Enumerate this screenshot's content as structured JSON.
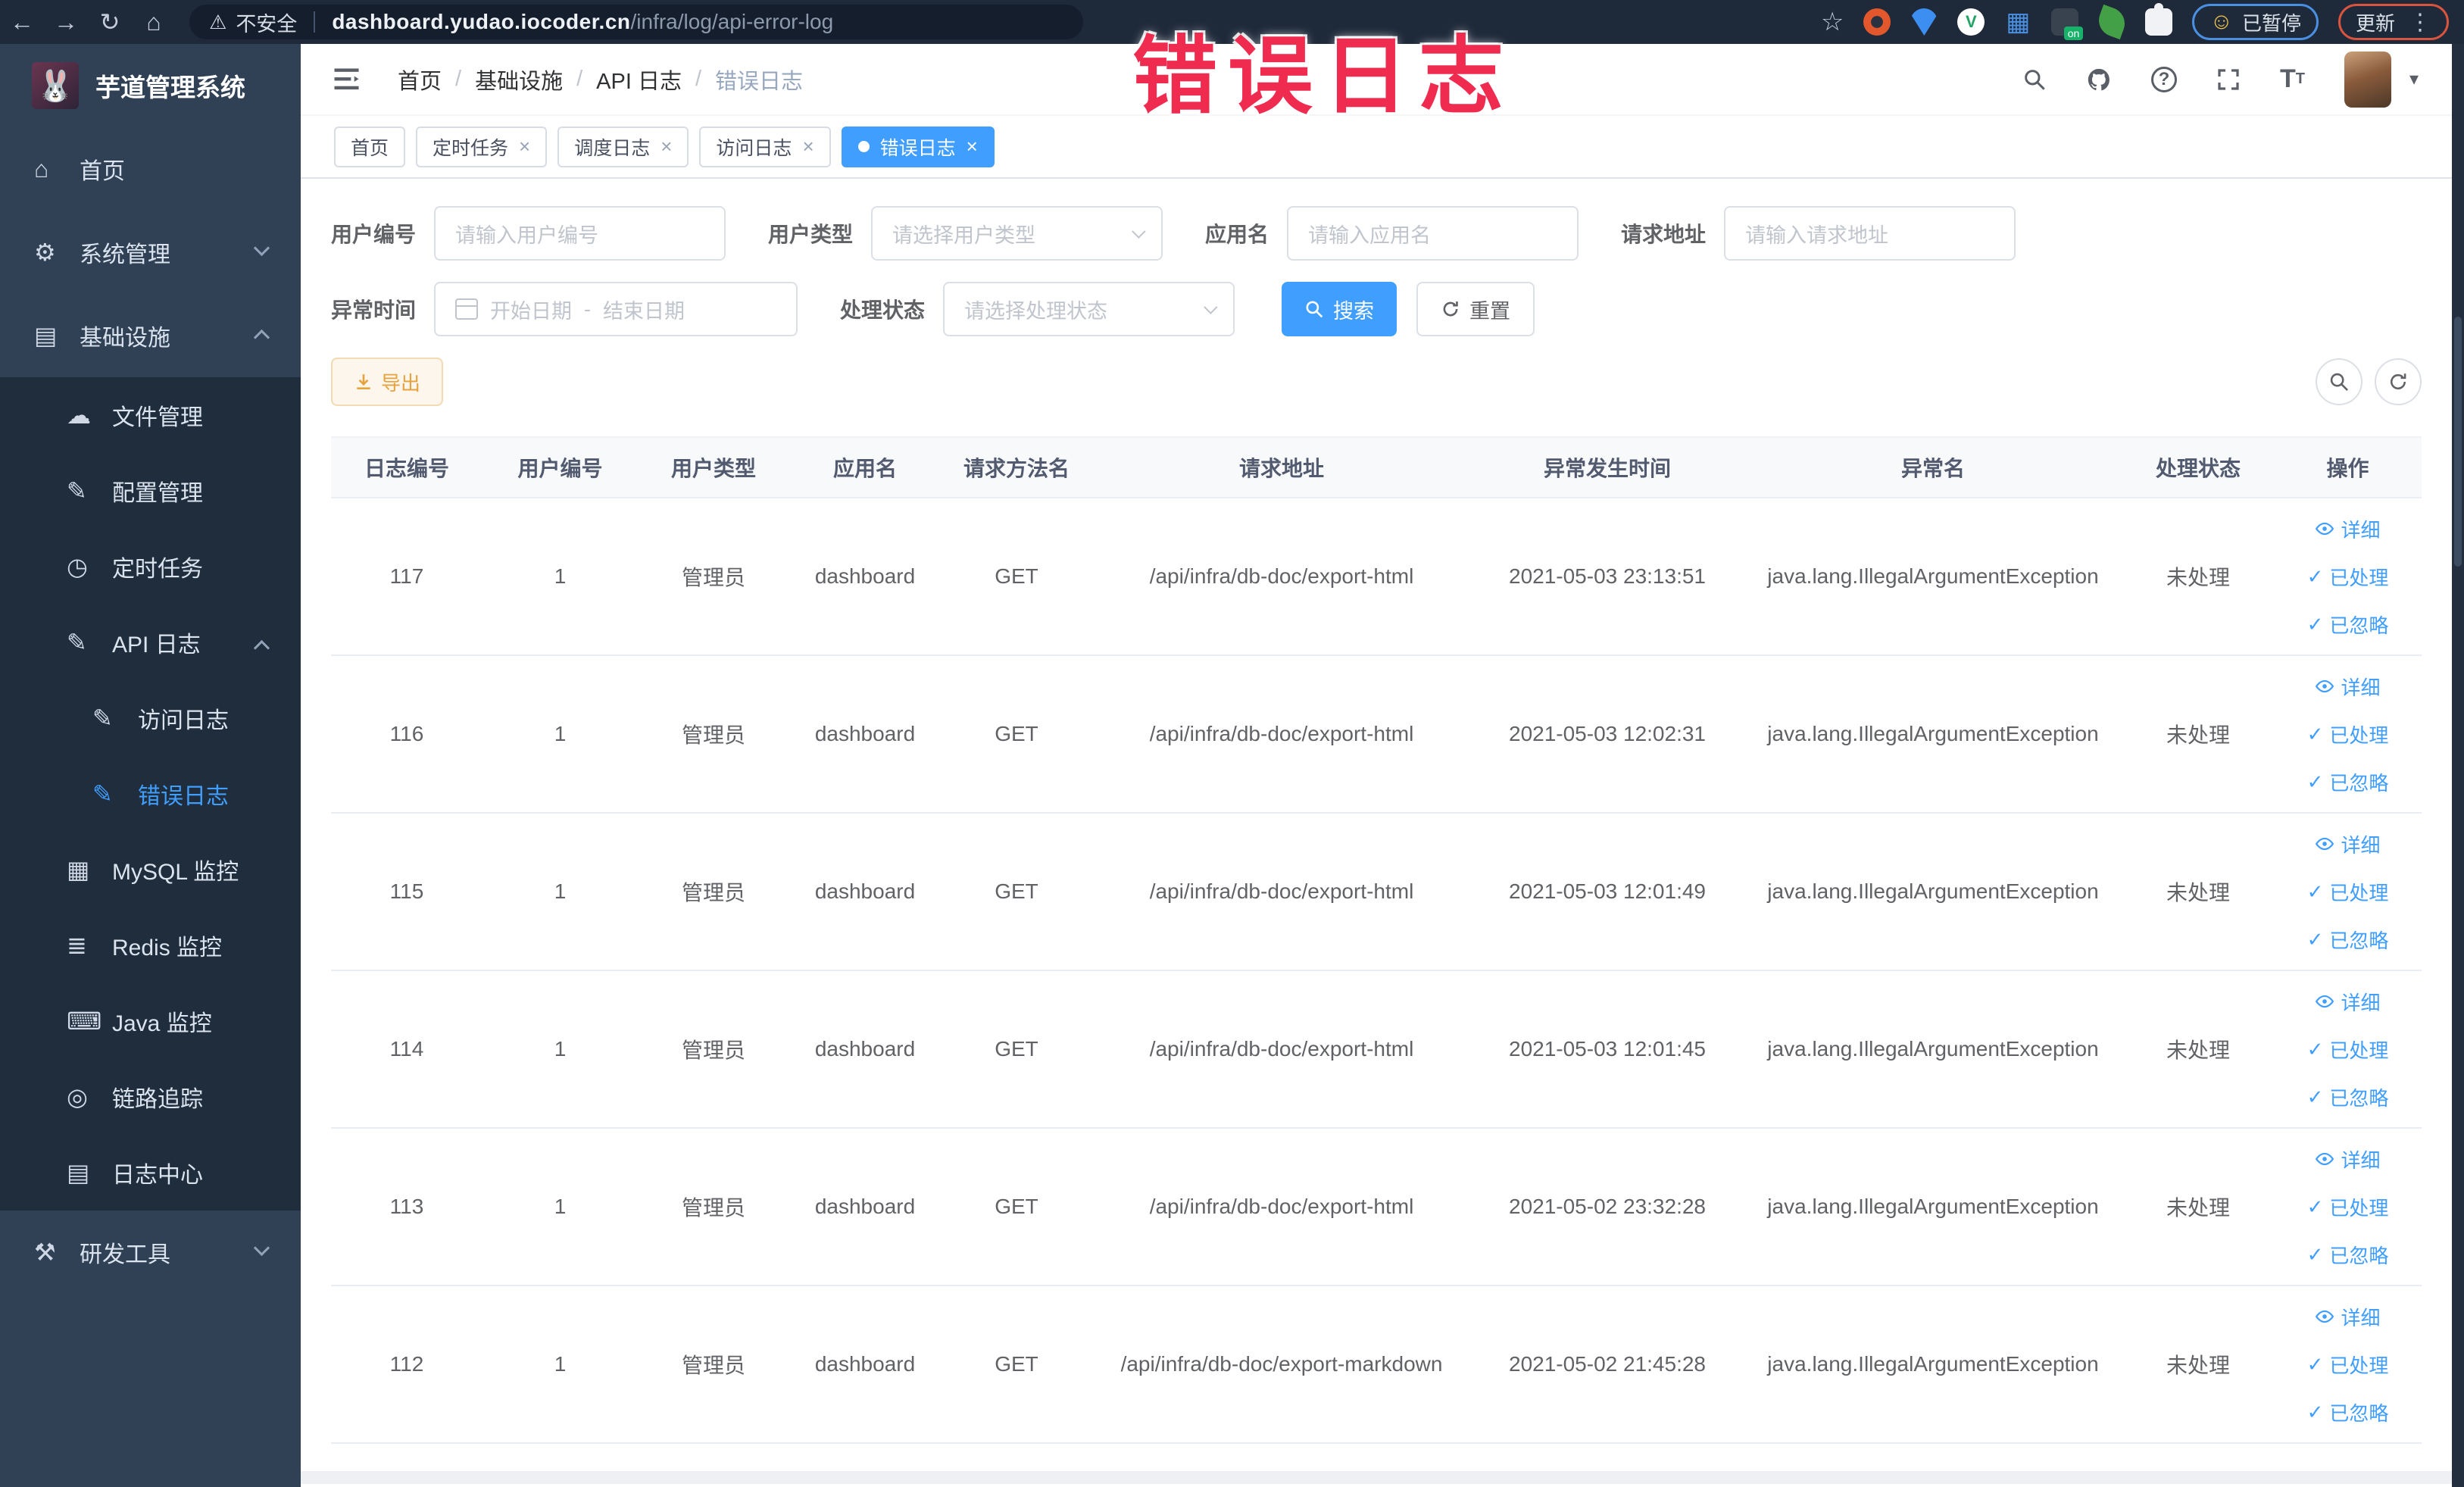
{
  "browser": {
    "security_label": "不安全",
    "url_domain": "dashboard.yudao.iocoder.cn",
    "url_path": "/infra/log/api-error-log",
    "paused_label": "已暂停",
    "update_label": "更新"
  },
  "overlay": {
    "text": "错误日志"
  },
  "colors": {
    "accent": "#409eff",
    "warning": "#e6a23c",
    "warning-bg": "#fdf6ec",
    "warning-border": "#f5dab1",
    "overlay": "#ef2b50",
    "sidebar-bg": "#304156",
    "submenu-bg": "#1f2d3d",
    "chrome-bg": "#1e2939"
  },
  "sidebar": {
    "title": "芋道管理系统",
    "home": "首页",
    "system": "系统管理",
    "infra": "基础设施",
    "sub": {
      "file": "文件管理",
      "config": "配置管理",
      "job": "定时任务",
      "apilog": "API 日志",
      "accesslog": "访问日志",
      "errorlog": "错误日志",
      "mysql": "MySQL 监控",
      "redis": "Redis 监控",
      "java": "Java 监控",
      "trace": "链路追踪",
      "logcenter": "日志中心"
    },
    "devtool": "研发工具"
  },
  "breadcrumb": {
    "items": [
      "首页",
      "基础设施",
      "API 日志",
      "错误日志"
    ]
  },
  "tabs": {
    "items": [
      {
        "label": "首页",
        "active": false,
        "closable": false
      },
      {
        "label": "定时任务",
        "active": false,
        "closable": true
      },
      {
        "label": "调度日志",
        "active": false,
        "closable": true
      },
      {
        "label": "访问日志",
        "active": false,
        "closable": true
      },
      {
        "label": "错误日志",
        "active": true,
        "closable": true
      }
    ]
  },
  "filters": {
    "user_id": {
      "label": "用户编号",
      "placeholder": "请输入用户编号"
    },
    "user_type": {
      "label": "用户类型",
      "placeholder": "请选择用户类型"
    },
    "app_name": {
      "label": "应用名",
      "placeholder": "请输入应用名"
    },
    "request_url": {
      "label": "请求地址",
      "placeholder": "请输入请求地址"
    },
    "exception_time": {
      "label": "异常时间",
      "start_placeholder": "开始日期",
      "separator": "-",
      "end_placeholder": "结束日期"
    },
    "process_status": {
      "label": "处理状态",
      "placeholder": "请选择处理状态"
    },
    "search_label": "搜索",
    "reset_label": "重置"
  },
  "toolbar": {
    "export_label": "导出"
  },
  "table": {
    "columns": [
      "日志编号",
      "用户编号",
      "用户类型",
      "应用名",
      "请求方法名",
      "请求地址",
      "异常发生时间",
      "异常名",
      "处理状态",
      "操作"
    ],
    "actions": {
      "detail": "详细",
      "processed": "已处理",
      "ignored": "已忽略"
    },
    "rows": [
      {
        "id": "117",
        "user_id": "1",
        "user_type": "管理员",
        "app_name": "dashboard",
        "method": "GET",
        "request_url": "/api/infra/db-doc/export-html",
        "exception_time": "2021-05-03 23:13:51",
        "exception_name": "java.lang.IllegalArgumentException",
        "process_status": "未处理"
      },
      {
        "id": "116",
        "user_id": "1",
        "user_type": "管理员",
        "app_name": "dashboard",
        "method": "GET",
        "request_url": "/api/infra/db-doc/export-html",
        "exception_time": "2021-05-03 12:02:31",
        "exception_name": "java.lang.IllegalArgumentException",
        "process_status": "未处理"
      },
      {
        "id": "115",
        "user_id": "1",
        "user_type": "管理员",
        "app_name": "dashboard",
        "method": "GET",
        "request_url": "/api/infra/db-doc/export-html",
        "exception_time": "2021-05-03 12:01:49",
        "exception_name": "java.lang.IllegalArgumentException",
        "process_status": "未处理"
      },
      {
        "id": "114",
        "user_id": "1",
        "user_type": "管理员",
        "app_name": "dashboard",
        "method": "GET",
        "request_url": "/api/infra/db-doc/export-html",
        "exception_time": "2021-05-03 12:01:45",
        "exception_name": "java.lang.IllegalArgumentException",
        "process_status": "未处理"
      },
      {
        "id": "113",
        "user_id": "1",
        "user_type": "管理员",
        "app_name": "dashboard",
        "method": "GET",
        "request_url": "/api/infra/db-doc/export-html",
        "exception_time": "2021-05-02 23:32:28",
        "exception_name": "java.lang.IllegalArgumentException",
        "process_status": "未处理"
      },
      {
        "id": "112",
        "user_id": "1",
        "user_type": "管理员",
        "app_name": "dashboard",
        "method": "GET",
        "request_url": "/api/infra/db-doc/export-markdown",
        "exception_time": "2021-05-02 21:45:28",
        "exception_name": "java.lang.IllegalArgumentException",
        "process_status": "未处理"
      }
    ]
  }
}
